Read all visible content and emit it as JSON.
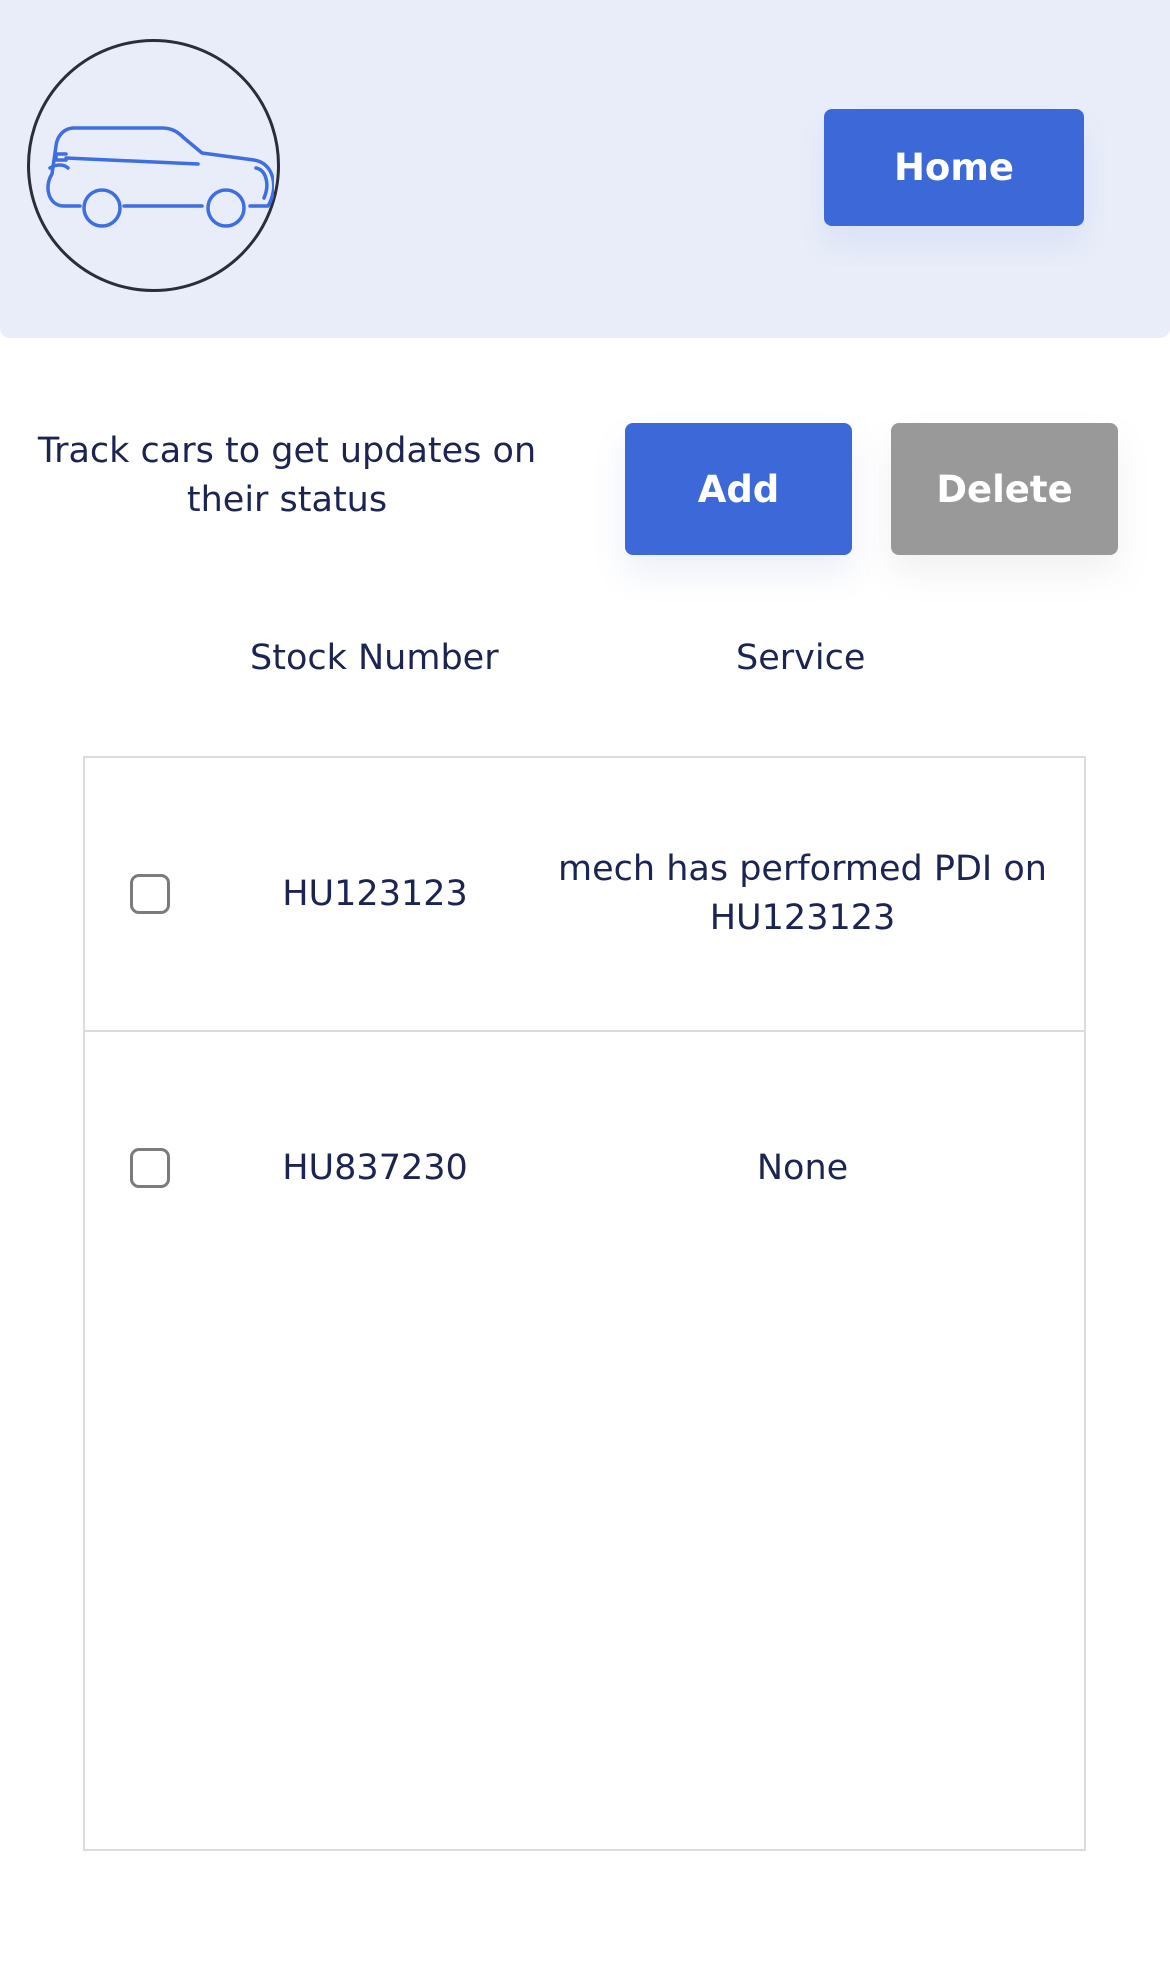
{
  "header": {
    "logo_icon": "car-icon",
    "home_label": "Home"
  },
  "intro": {
    "text": "Track cars to get updates on their status"
  },
  "actions": {
    "add_label": "Add",
    "delete_label": "Delete"
  },
  "table": {
    "columns": [
      "Stock Number",
      "Service"
    ],
    "rows": [
      {
        "checked": false,
        "stock_number": "HU123123",
        "service": "mech has performed PDI on HU123123"
      },
      {
        "checked": false,
        "stock_number": "HU837230",
        "service": "None"
      }
    ]
  },
  "colors": {
    "accent": "#3d68d8",
    "disabled": "#999999",
    "header_bg": "#e9edf9",
    "text": "#1c2452"
  }
}
